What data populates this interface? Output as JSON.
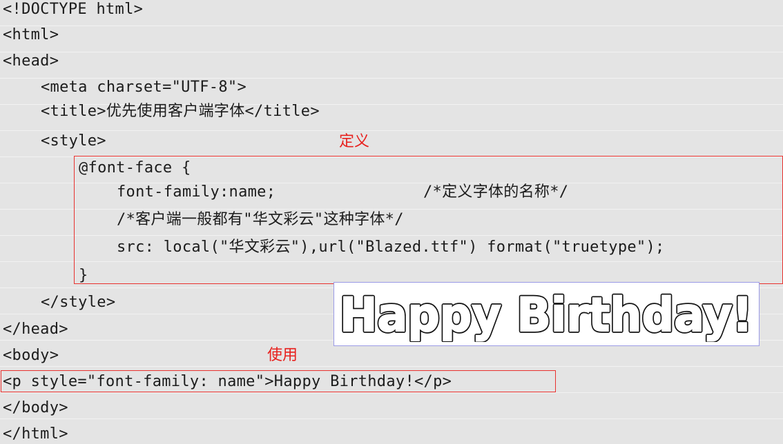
{
  "code_lines": [
    "<!DOCTYPE html>",
    "<html>",
    "<head>",
    "<meta charset=\"UTF-8\">",
    "<title>优先使用客户端字体</title>",
    "<style>",
    "@font-face {",
    "font-family:name;",
    "/*定义字体的名称*/",
    "/*客户端一般都有\"华文彩云\"这种字体*/",
    "src: local(\"华文彩云\"),url(\"Blazed.ttf\") format(\"truetype\");",
    "}",
    "</style>",
    "</head>",
    "<body>",
    "<p style=\"font-family: name\">Happy Birthday!</p>",
    "</body>",
    "</html>"
  ],
  "annotations": {
    "define_label": "定义",
    "use_label": "使用",
    "accent_color": "#e8201d"
  },
  "preview": {
    "text": "Happy Birthday!"
  }
}
